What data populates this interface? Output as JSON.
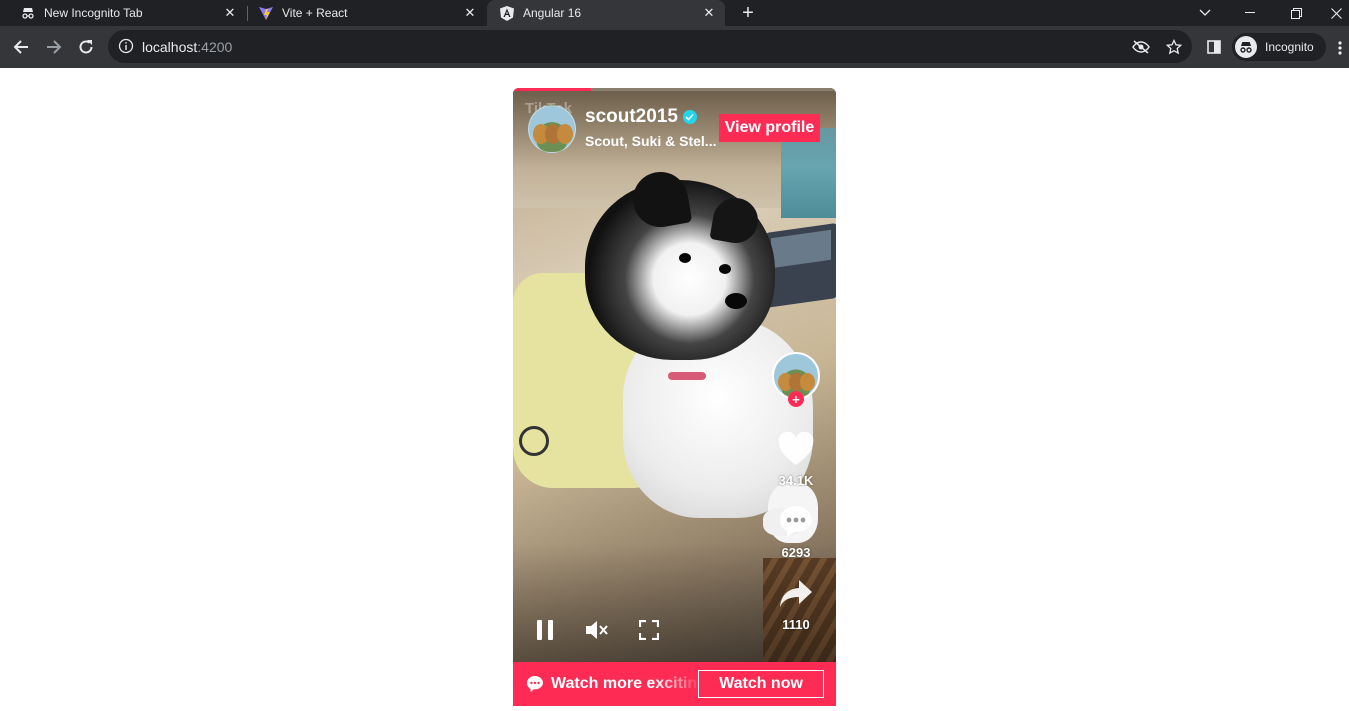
{
  "browser": {
    "tabs": [
      {
        "title": "New Incognito Tab",
        "icon": "incognito-icon",
        "active": false
      },
      {
        "title": "Vite + React",
        "icon": "vite-icon",
        "active": false
      },
      {
        "title": "Angular 16",
        "icon": "angular-icon",
        "active": true
      }
    ],
    "address": {
      "host": "localhost",
      "port": ":4200"
    },
    "profile_label": "Incognito"
  },
  "video": {
    "progress_percent": 24,
    "watermark": "TikTok",
    "author": {
      "username": "scout2015",
      "nickname": "Scout, Suki & Stel...",
      "verified": true
    },
    "view_profile_label": "View profile",
    "stats": {
      "likes": "34.1K",
      "comments": "6293",
      "shares": "1110"
    },
    "controls": [
      "pause-icon",
      "mute-icon",
      "fullscreen-icon"
    ],
    "banner": {
      "text": "Watch more exciting videos on TikTok",
      "button_label": "Watch now"
    }
  },
  "colors": {
    "accent": "#fe2c55",
    "verified": "#20d5ec",
    "chrome_dark": "#202124",
    "chrome_toolbar": "#35363a"
  }
}
